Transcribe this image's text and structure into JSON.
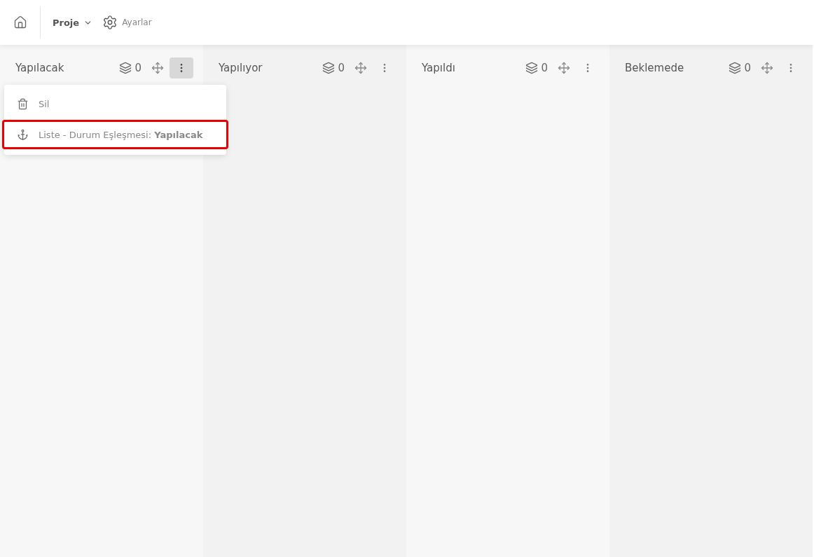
{
  "topbar": {
    "project": "Proje",
    "settings": "Ayarlar"
  },
  "columns": [
    {
      "title": "Yapılacak",
      "count": "0",
      "menu_open": true
    },
    {
      "title": "Yapılıyor",
      "count": "0",
      "menu_open": false
    },
    {
      "title": "Yapıldı",
      "count": "0",
      "menu_open": false
    },
    {
      "title": "Beklemede",
      "count": "0",
      "menu_open": false
    }
  ],
  "menu": {
    "items": [
      {
        "kind": "delete",
        "text": "Sil",
        "highlighted": false
      },
      {
        "kind": "anchor",
        "text": "Liste - Durum Eşleşmesi: **Yapılacak**",
        "highlighted": true
      }
    ]
  }
}
